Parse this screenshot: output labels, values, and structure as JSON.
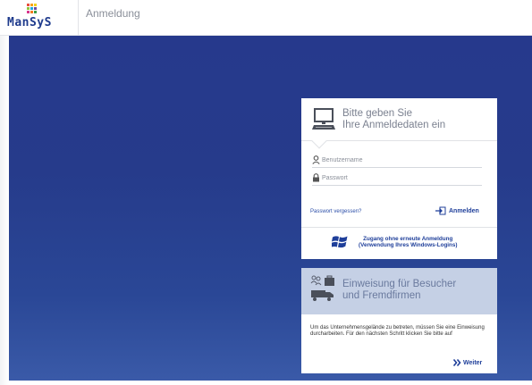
{
  "app": {
    "logo_text": "ManSyS",
    "page_title": "Anmeldung"
  },
  "login": {
    "title_line1": "Bitte geben Sie",
    "title_line2": "Ihre Anmeldedaten ein",
    "username_placeholder": "Benutzername",
    "password_placeholder": "Passwort",
    "forgot_password": "Passwort vergessen?",
    "login_button": "Anmelden",
    "windows_line1": "Zugang ohne erneute Anmeldung",
    "windows_line2": "(Verwendung Ihres Windows-Logins)"
  },
  "visitor": {
    "title_line1": "Einweisung für Besucher",
    "title_line2": "und Fremdfirmen",
    "description": "Um das Unternehmensgelände zu betreten, müssen Sie eine Einweisung durcharbeiten. Für den nächsten Schritt klicken Sie bitte auf",
    "next_button": "Weiter"
  },
  "colors": {
    "background_top": "#26398c",
    "accent": "#1f3f9a",
    "visitor_panel": "#c5d0e5"
  }
}
